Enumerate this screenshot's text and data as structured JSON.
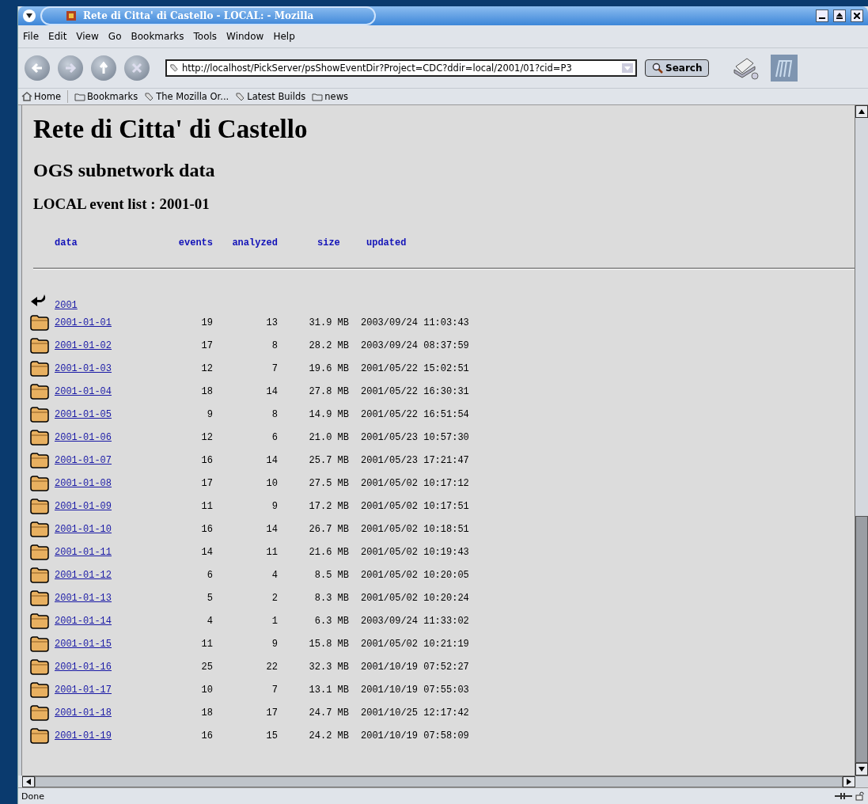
{
  "window": {
    "title": "Rete di Citta' di Castello - LOCAL: - Mozilla"
  },
  "menu": [
    "File",
    "Edit",
    "View",
    "Go",
    "Bookmarks",
    "Tools",
    "Window",
    "Help"
  ],
  "toolbar": {
    "url": "http://localhost/PickServer/psShowEventDir?Project=CDC?ddir=local/2001/01?cid=P3",
    "search_button": "Search"
  },
  "personal_bar": [
    {
      "label": "Home",
      "kind": "home"
    },
    {
      "label": "Bookmarks",
      "kind": "folder"
    },
    {
      "label": "The Mozilla Or...",
      "kind": "link"
    },
    {
      "label": "Latest Builds",
      "kind": "link"
    },
    {
      "label": "news",
      "kind": "folder"
    }
  ],
  "page": {
    "heading": "Rete di Citta' di Castello",
    "subheading": "OGS subnetwork data",
    "list_title": "LOCAL event list : 2001-01",
    "columns": [
      "data",
      "events",
      "analyzed",
      "size",
      "updated"
    ],
    "parent_link": "2001",
    "rows": [
      {
        "name": "2001-01-01",
        "events": "19",
        "analyzed": "13",
        "size": "31.9 MB",
        "updated": "2003/09/24 11:03:43"
      },
      {
        "name": "2001-01-02",
        "events": "17",
        "analyzed": "8",
        "size": "28.2 MB",
        "updated": "2003/09/24 08:37:59"
      },
      {
        "name": "2001-01-03",
        "events": "12",
        "analyzed": "7",
        "size": "19.6 MB",
        "updated": "2001/05/22 15:02:51"
      },
      {
        "name": "2001-01-04",
        "events": "18",
        "analyzed": "14",
        "size": "27.8 MB",
        "updated": "2001/05/22 16:30:31"
      },
      {
        "name": "2001-01-05",
        "events": "9",
        "analyzed": "8",
        "size": "14.9 MB",
        "updated": "2001/05/22 16:51:54"
      },
      {
        "name": "2001-01-06",
        "events": "12",
        "analyzed": "6",
        "size": "21.0 MB",
        "updated": "2001/05/23 10:57:30"
      },
      {
        "name": "2001-01-07",
        "events": "16",
        "analyzed": "14",
        "size": "25.7 MB",
        "updated": "2001/05/23 17:21:47"
      },
      {
        "name": "2001-01-08",
        "events": "17",
        "analyzed": "10",
        "size": "27.5 MB",
        "updated": "2001/05/02 10:17:12"
      },
      {
        "name": "2001-01-09",
        "events": "11",
        "analyzed": "9",
        "size": "17.2 MB",
        "updated": "2001/05/02 10:17:51"
      },
      {
        "name": "2001-01-10",
        "events": "16",
        "analyzed": "14",
        "size": "26.7 MB",
        "updated": "2001/05/02 10:18:51"
      },
      {
        "name": "2001-01-11",
        "events": "14",
        "analyzed": "11",
        "size": "21.6 MB",
        "updated": "2001/05/02 10:19:43"
      },
      {
        "name": "2001-01-12",
        "events": "6",
        "analyzed": "4",
        "size": "8.5 MB",
        "updated": "2001/05/02 10:20:05"
      },
      {
        "name": "2001-01-13",
        "events": "5",
        "analyzed": "2",
        "size": "8.3 MB",
        "updated": "2001/05/02 10:20:24"
      },
      {
        "name": "2001-01-14",
        "events": "4",
        "analyzed": "1",
        "size": "6.3 MB",
        "updated": "2003/09/24 11:33:02"
      },
      {
        "name": "2001-01-15",
        "events": "11",
        "analyzed": "9",
        "size": "15.8 MB",
        "updated": "2001/05/02 10:21:19"
      },
      {
        "name": "2001-01-16",
        "events": "25",
        "analyzed": "22",
        "size": "32.3 MB",
        "updated": "2001/10/19 07:52:27"
      },
      {
        "name": "2001-01-17",
        "events": "10",
        "analyzed": "7",
        "size": "13.1 MB",
        "updated": "2001/10/19 07:55:03"
      },
      {
        "name": "2001-01-18",
        "events": "18",
        "analyzed": "17",
        "size": "24.7 MB",
        "updated": "2001/10/25 12:17:42"
      },
      {
        "name": "2001-01-19",
        "events": "16",
        "analyzed": "15",
        "size": "24.2 MB",
        "updated": "2001/10/19 07:58:09"
      }
    ]
  },
  "status_bar": "Done"
}
